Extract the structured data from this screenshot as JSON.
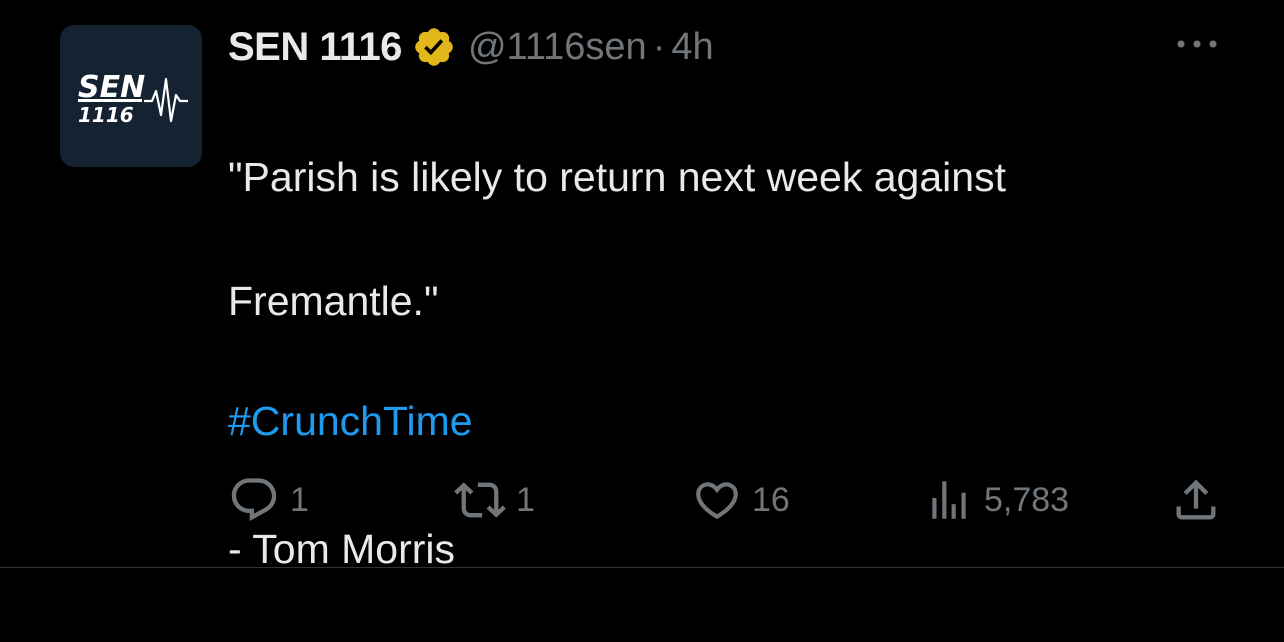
{
  "author": {
    "display_name": "SEN 1116",
    "handle": "@1116sen",
    "separator": "·",
    "time": "4h",
    "avatar": {
      "brand_text": "SEN",
      "number_text": "1116",
      "background": "#152231"
    },
    "verified_badge": {
      "icon": "verified-badge-icon",
      "color": "#e2b719"
    }
  },
  "tweet": {
    "line_1": "\"Parish is likely to return next week against",
    "line_2": "Fremantle.\"",
    "line_3": "- Tom Morris",
    "hashtag": "#CrunchTime"
  },
  "actions": {
    "reply": {
      "icon": "reply-icon",
      "count": "1"
    },
    "retweet": {
      "icon": "retweet-icon",
      "count": "1"
    },
    "like": {
      "icon": "heart-icon",
      "count": "16"
    },
    "views": {
      "icon": "views-icon",
      "count": "5,783"
    },
    "share": {
      "icon": "share-icon"
    }
  },
  "menu": {
    "icon": "more-options-icon"
  },
  "colors": {
    "background": "#000000",
    "text_primary": "#e7e9ea",
    "text_secondary": "#71767b",
    "link": "#1d9bf0",
    "verified": "#e2b719"
  }
}
